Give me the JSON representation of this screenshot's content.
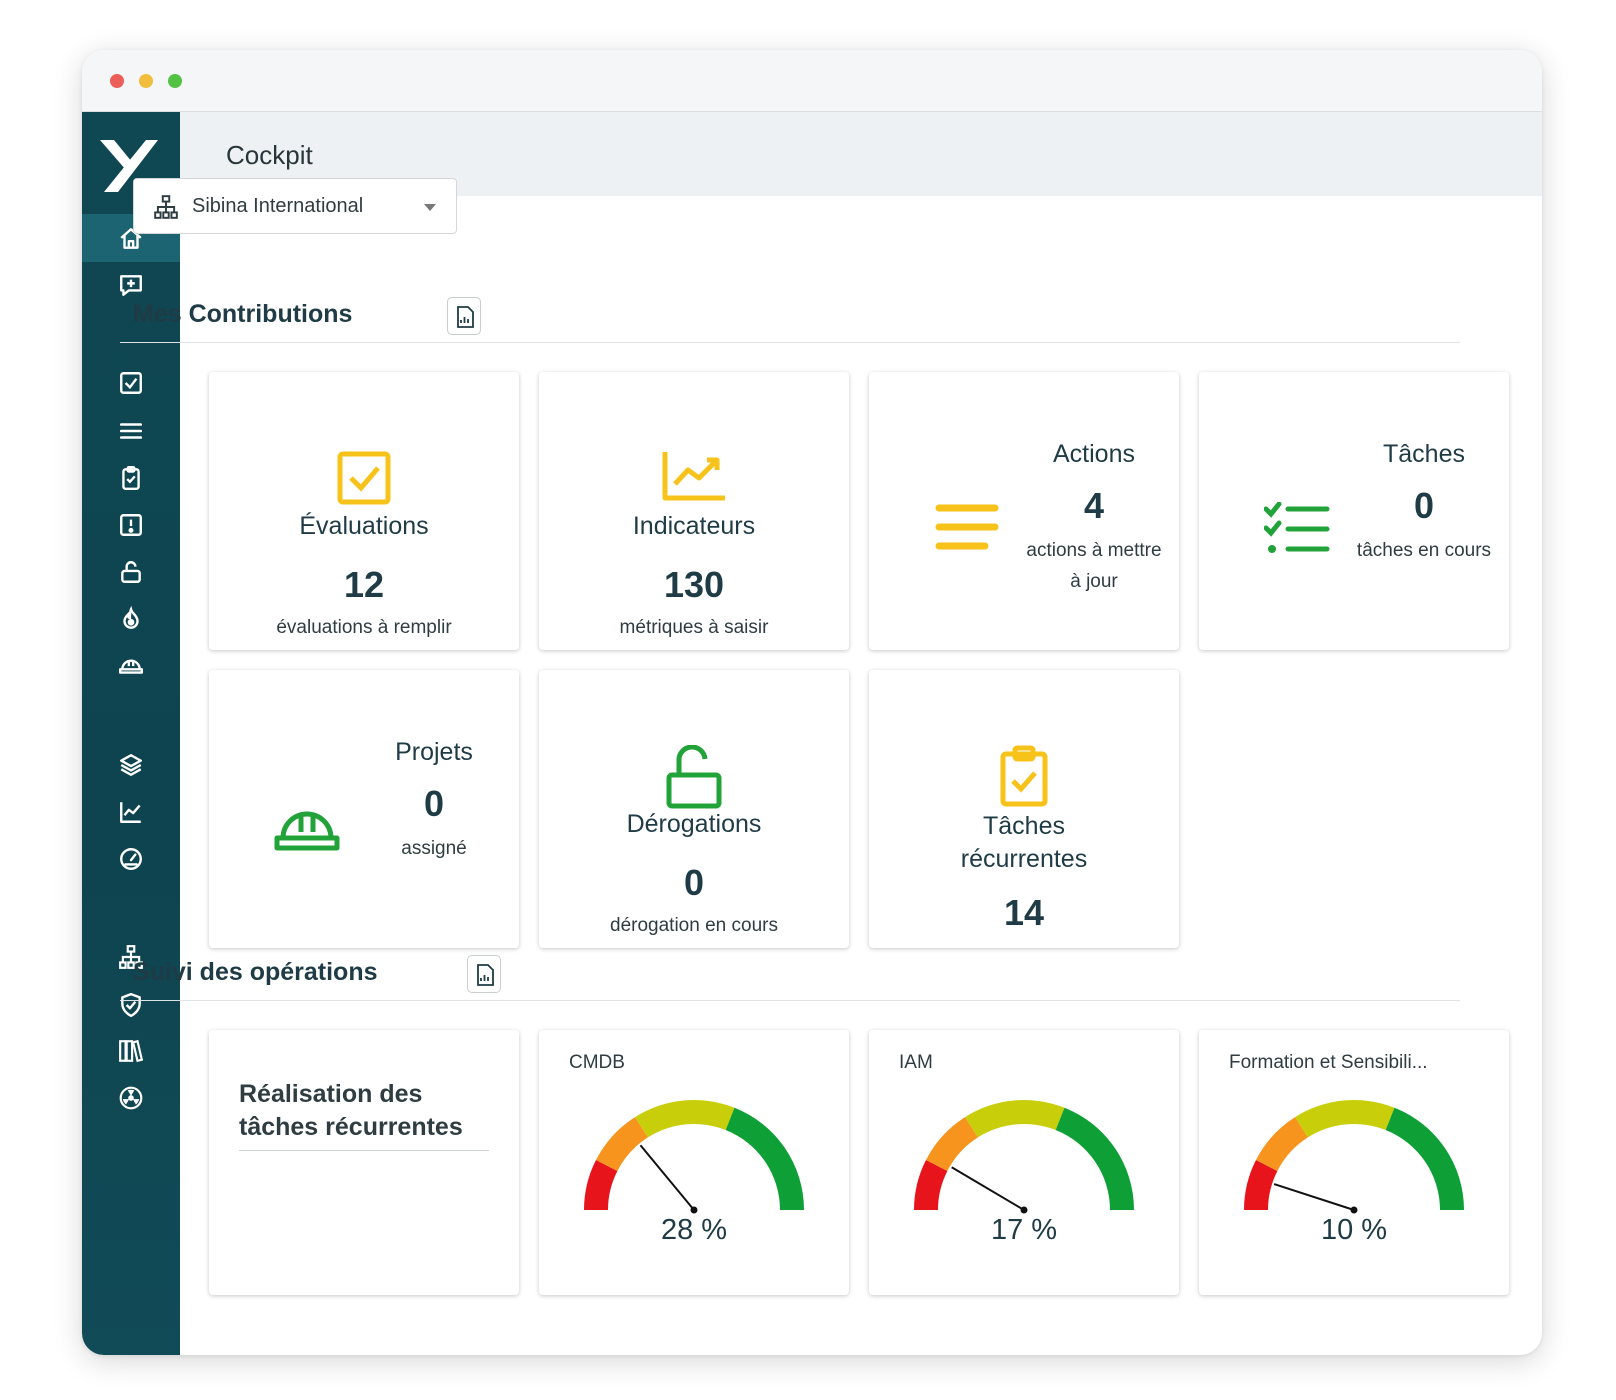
{
  "page": {
    "title": "Cockpit"
  },
  "org_selector": {
    "value": "Sibina International"
  },
  "sections": {
    "contributions": "Mes Contributions",
    "operations": "Suivi des opérations"
  },
  "cards": {
    "evaluations": {
      "title": "Évaluations",
      "value": "12",
      "sub": "évaluations à remplir"
    },
    "indicateurs": {
      "title": "Indicateurs",
      "value": "130",
      "sub": "métriques à saisir"
    },
    "actions": {
      "title": "Actions",
      "value": "4",
      "sub": "actions à mettre à jour"
    },
    "taches": {
      "title": "Tâches",
      "value": "0",
      "sub": "tâches en cours"
    },
    "projets": {
      "title": "Projets",
      "value": "0",
      "sub": "assigné"
    },
    "derogations": {
      "title": "Dérogations",
      "value": "0",
      "sub": "dérogation en cours"
    },
    "recurrentes": {
      "title": "Tâches récurrentes",
      "value": "14"
    }
  },
  "recurring_panel": {
    "title": "Réalisation des tâches récurrentes"
  },
  "gauges": [
    {
      "label": "CMDB",
      "value": 28,
      "display": "28 %"
    },
    {
      "label": "IAM",
      "value": 17,
      "display": "17 %"
    },
    {
      "label": "Formation et Sensibili...",
      "value": 10,
      "display": "10 %"
    }
  ],
  "colors": {
    "sidebar": "#0f4753",
    "accent_yellow": "#f7c21a",
    "accent_green": "#22a33a",
    "gauge_red": "#e8141c",
    "gauge_orange": "#f7941d",
    "gauge_yellowgreen": "#c8cf0a",
    "gauge_green": "#0e9f36"
  },
  "nav_icons": [
    "home-icon",
    "add-comment-icon",
    "check-square-icon",
    "list-icon",
    "clipboard-check-icon",
    "alert-box-icon",
    "unlock-icon",
    "fire-icon",
    "helmet-icon",
    "layers-icon",
    "chart-line-icon",
    "speedometer-icon",
    "org-chart-icon",
    "shield-check-icon",
    "library-icon",
    "radioactive-icon"
  ]
}
